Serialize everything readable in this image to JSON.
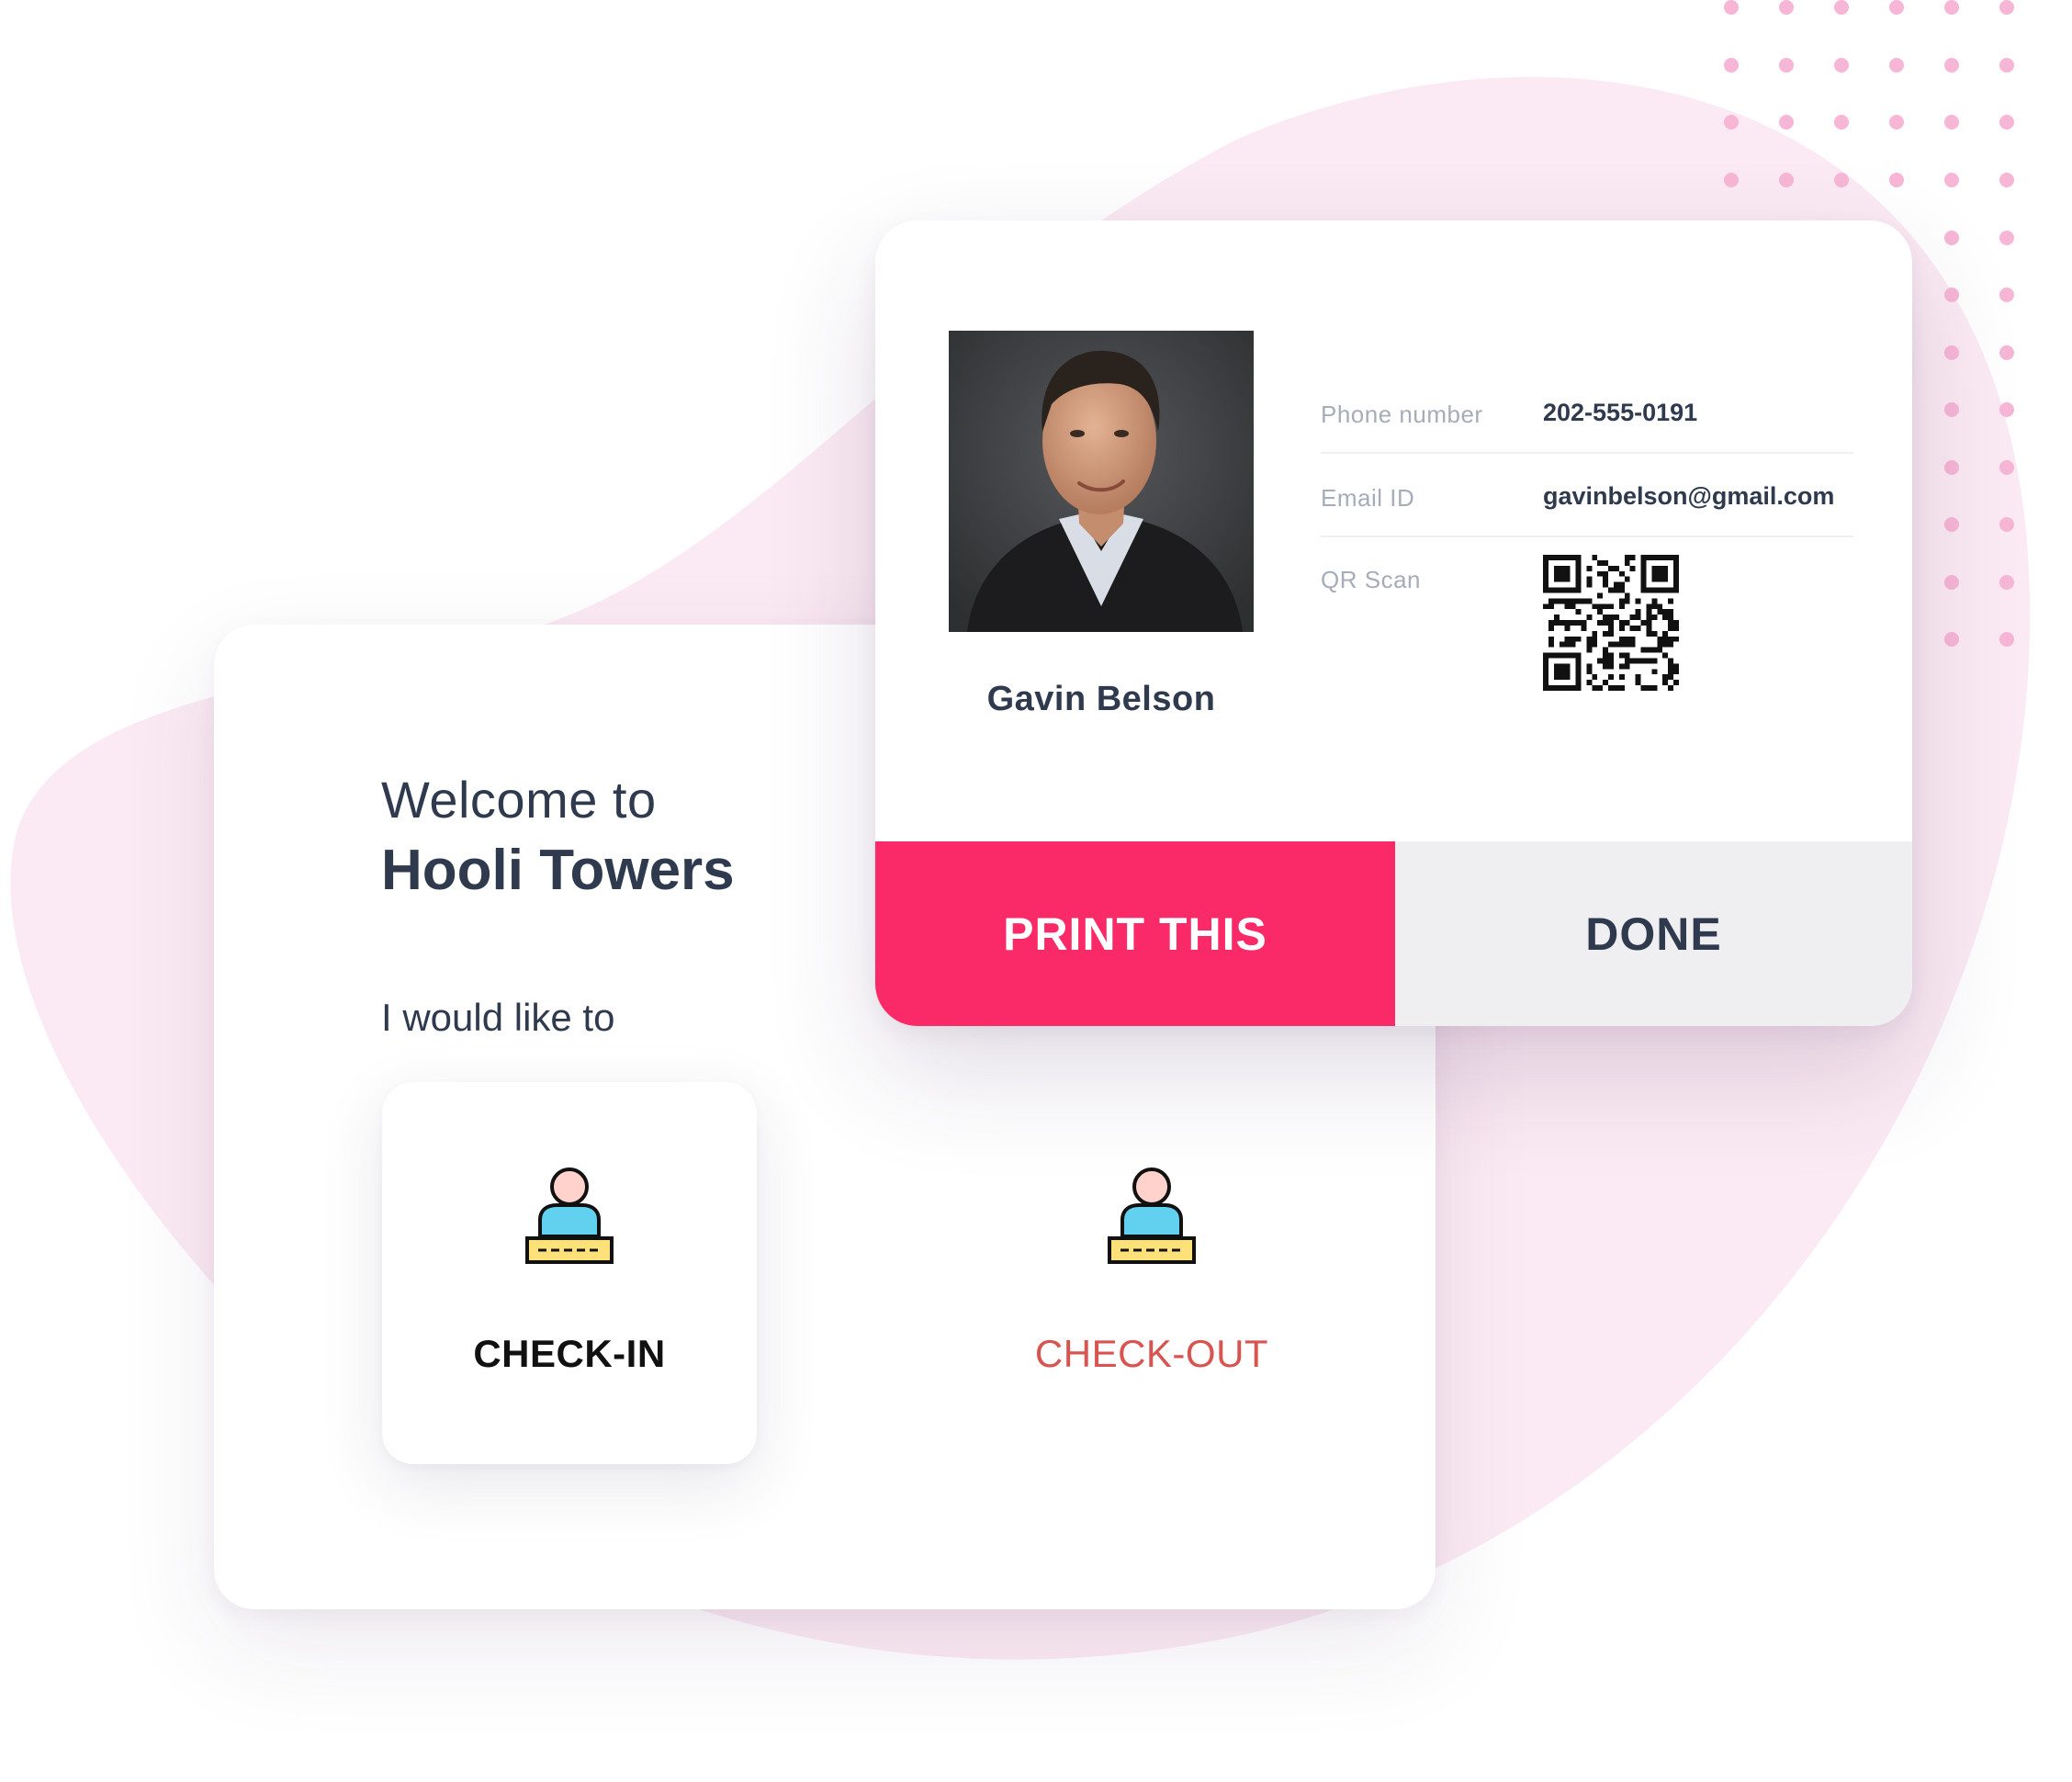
{
  "kiosk": {
    "welcome_line": "Welcome to",
    "venue_name": "Hooli Towers",
    "prompt": "I would like to",
    "options": [
      {
        "label": "CHECK-IN",
        "icon": "visitor-badge-icon",
        "selected": true
      },
      {
        "label": "CHECK-OUT",
        "icon": "visitor-badge-icon",
        "selected": false
      }
    ]
  },
  "badge": {
    "visitor_name": "Gavin Belson",
    "photo": "visitor-photo",
    "fields": [
      {
        "label": "Phone number",
        "value": "202-555-0191"
      },
      {
        "label": "Email ID",
        "value": "gavinbelson@gmail.com"
      },
      {
        "label": "QR Scan",
        "value_icon": "qr-code-icon"
      }
    ],
    "print_label": "PRINT THIS",
    "done_label": "DONE"
  },
  "colors": {
    "accent": "#fa2a68",
    "checkout_text": "#d9534f",
    "heading_text": "#2f3a4e",
    "muted_label": "#a6acb8",
    "background_blob": "#fbeaf3",
    "dot_pattern": "#f7b6d6"
  }
}
